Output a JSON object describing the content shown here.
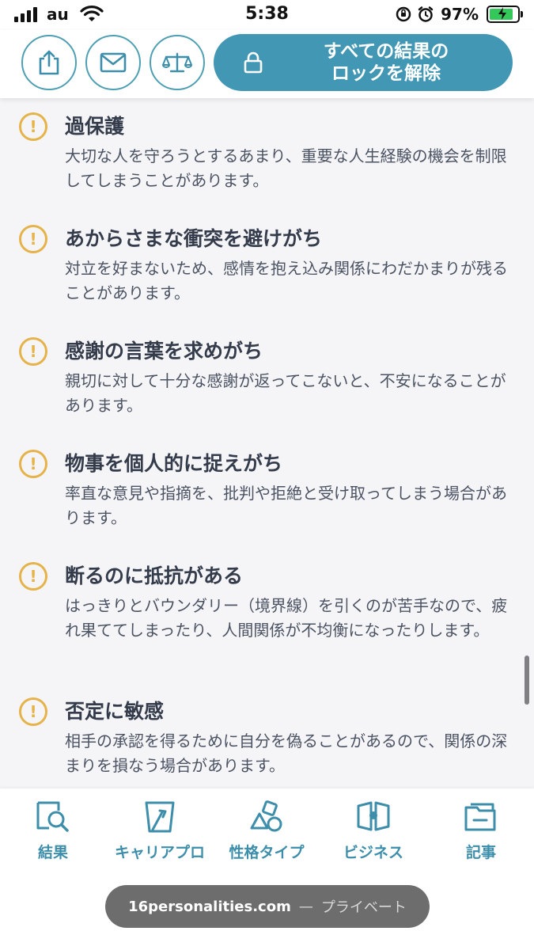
{
  "status_bar": {
    "carrier": "au",
    "time": "5:38",
    "battery_percent": "97%",
    "battery_level": 0.97
  },
  "toolbar": {
    "share_icon": "share-icon",
    "email_icon": "mail-icon",
    "compare_icon": "scale-icon",
    "unlock_label": "すべての結果の\nロックを解除"
  },
  "weaknesses": [
    {
      "title": "過保護",
      "text": "大切な人を守ろうとするあまり、重要な人生経験の機会を制限してしまうことがあります。"
    },
    {
      "title": "あからさまな衝突を避けがち",
      "text": "対立を好まないため、感情を抱え込み関係にわだかまりが残ることがあります。"
    },
    {
      "title": "感謝の言葉を求めがち",
      "text": "親切に対して十分な感謝が返ってこないと、不安になることがあります。"
    },
    {
      "title": "物事を個人的に捉えがち",
      "text": "率直な意見や指摘を、批判や拒絶と受け取ってしまう場合があります。"
    },
    {
      "title": "断るのに抵抗がある",
      "text": "はっきりとバウンダリー（境界線）を引くのが苦手なので、疲れ果ててしまったり、人間関係が不均衡になったりします。"
    },
    {
      "title": "否定に敏感",
      "text": "相手の承認を得るために自分を偽ることがあるので、関係の深まりを損なう場合があります。"
    }
  ],
  "bottom_nav": [
    {
      "label": "結果",
      "icon": "results-icon"
    },
    {
      "label": "キャリアプロ",
      "icon": "career-icon"
    },
    {
      "label": "性格タイプ",
      "icon": "personality-types-icon"
    },
    {
      "label": "ビジネス",
      "icon": "business-icon"
    },
    {
      "label": "記事",
      "icon": "articles-icon"
    }
  ],
  "browser": {
    "domain": "16personalities.com",
    "separator": "—",
    "mode": "プライベート"
  },
  "colors": {
    "accent": "#4298b4",
    "warning": "#e6b34a",
    "background": "#f5f5f8"
  }
}
